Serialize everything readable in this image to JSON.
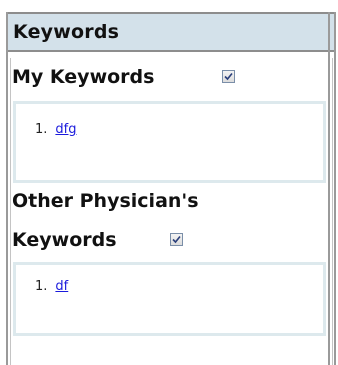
{
  "header": {
    "title": "Keywords"
  },
  "my_keywords": {
    "title": "My Keywords",
    "checked": true,
    "items": [
      {
        "number": "1.",
        "label": "dfg"
      }
    ]
  },
  "other_keywords": {
    "title_line1": "Other Physician's",
    "title_line2": "Keywords",
    "checked": true,
    "items": [
      {
        "number": "1.",
        "label": "df"
      }
    ]
  },
  "colors": {
    "header_bg": "#d3e1ea",
    "link": "#1a1adc",
    "box_border": "#dde9ed"
  },
  "icons": {
    "checkbox": "checkbox-checked-icon"
  }
}
